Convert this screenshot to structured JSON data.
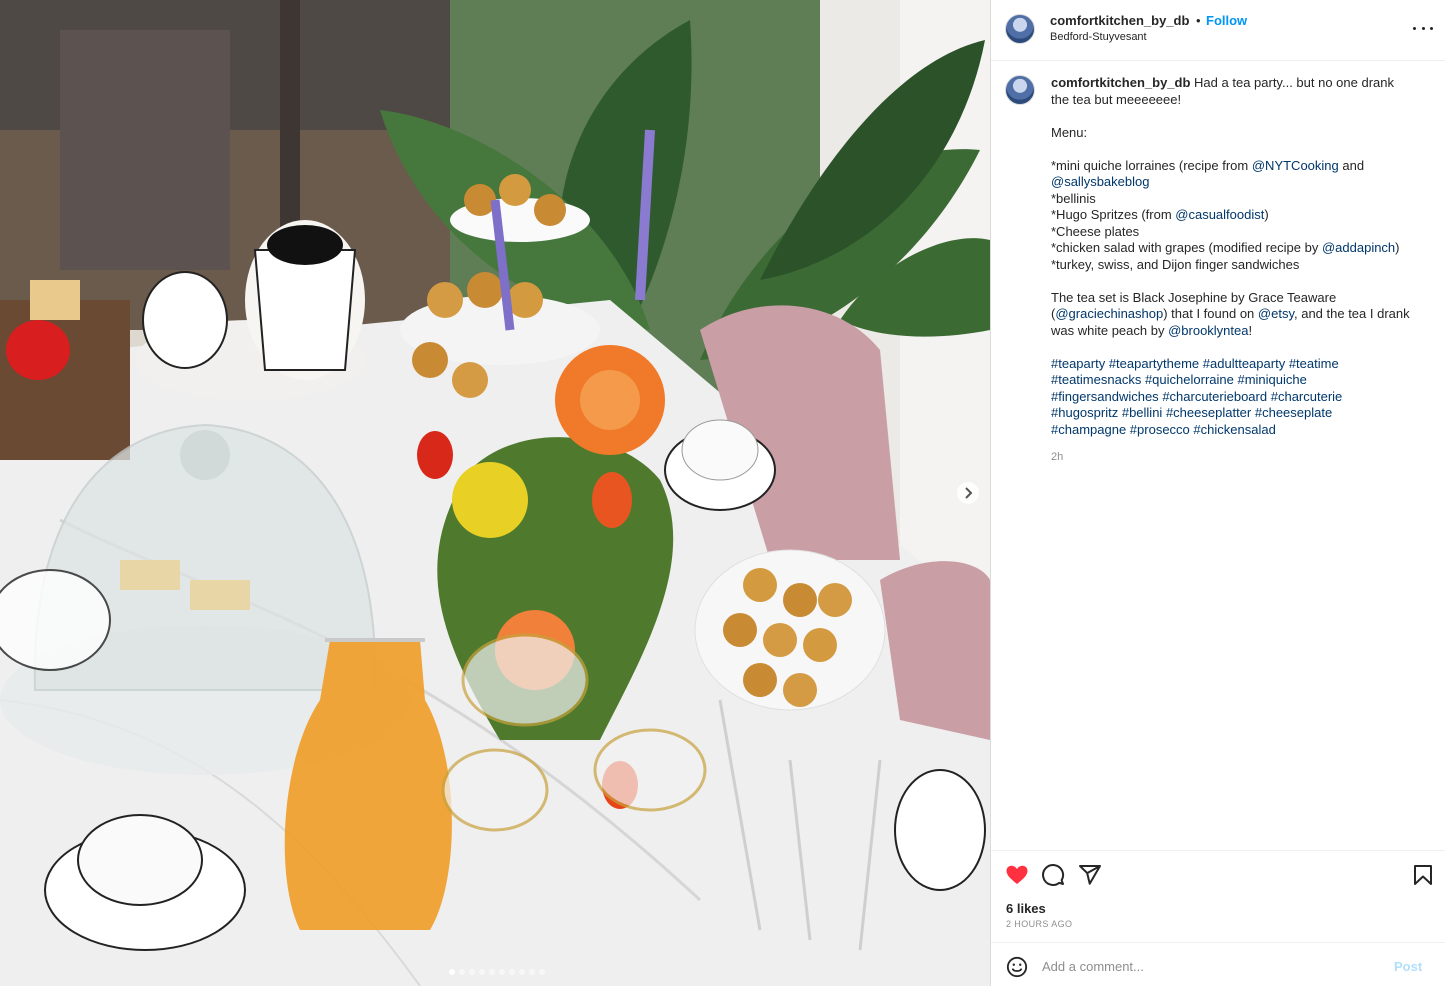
{
  "post": {
    "username": "comfortkitchen_by_db",
    "separator": "•",
    "follow_label": "Follow",
    "location": "Bedford-Stuyvesant"
  },
  "caption": {
    "username": "comfortkitchen_by_db",
    "line1": "Had a tea party... but no one drank",
    "line2": "the tea but meeeeeee!",
    "menu_heading": "Menu:",
    "item1_a": "*mini quiche lorraines (recipe from ",
    "item1_mention1": "@NYTCooking",
    "item1_b": " and",
    "item1_mention2": "@sallysbakeblog",
    "item2": "*bellinis",
    "item3_a": "*Hugo Spritzes (from ",
    "item3_mention": "@casualfoodist",
    "item3_b": ")",
    "item4": "*Cheese plates",
    "item5_a": "*chicken salad with grapes (modified recipe by ",
    "item5_mention": "@addapinch",
    "item5_b": ")",
    "item6": "*turkey, swiss, and Dijon finger sandwiches",
    "tea_a": "The tea set is Black Josephine by Grace Teaware",
    "tea_b_pre": "(",
    "tea_mention1": "@graciechinashop",
    "tea_b_mid": ") that I found on ",
    "tea_mention2": "@etsy",
    "tea_b_post": ", and the tea I drank",
    "tea_c_pre": "was white peach by ",
    "tea_mention3": "@brooklyntea",
    "tea_c_post": "!",
    "hashtags": [
      [
        "#teaparty",
        "#teapartytheme",
        "#adultteaparty",
        "#teatime"
      ],
      [
        "#teatimesnacks",
        "#quichelorraine",
        "#miniquiche"
      ],
      [
        "#fingersandwiches",
        "#charcuterieboard",
        "#charcuterie"
      ],
      [
        "#hugospritz",
        "#bellini",
        "#cheeseplatter",
        "#cheeseplate"
      ],
      [
        "#champagne",
        "#prosecco",
        "#chickensalad"
      ]
    ],
    "time": "2h"
  },
  "engagement": {
    "likes": "6 likes",
    "time_ago": "2 HOURS AGO"
  },
  "comment": {
    "placeholder": "Add a comment...",
    "post_label": "Post"
  },
  "icons": {
    "like": "heart-icon",
    "comment": "comment-icon",
    "share": "share-icon",
    "save": "bookmark-icon",
    "emoji": "emoji-icon",
    "more": "more-icon",
    "next": "chevron-right-icon"
  },
  "colors": {
    "like_active": "#ff3040",
    "follow": "#0095f6",
    "mention": "#00376b",
    "post_disabled": "#b2dffc"
  },
  "carousel": {
    "total": 10,
    "active": 1
  }
}
